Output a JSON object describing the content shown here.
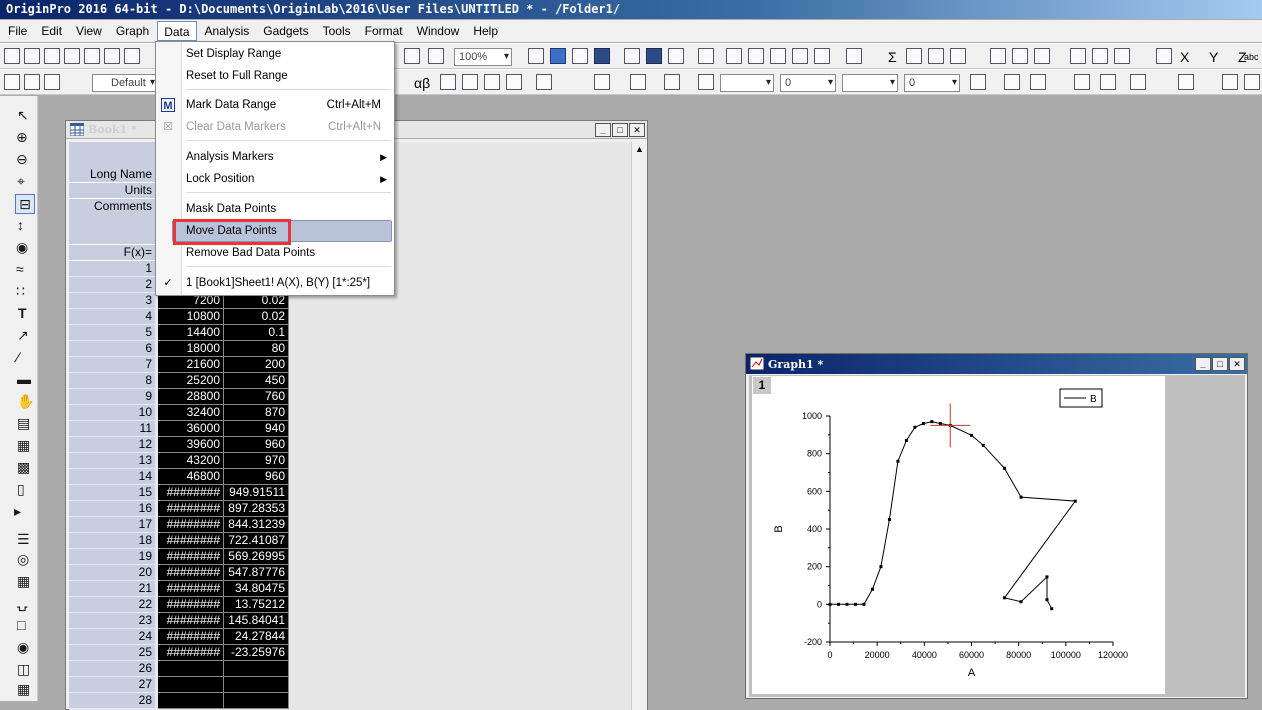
{
  "app": {
    "title": "OriginPro 2016 64-bit - D:\\Documents\\OriginLab\\2016\\User Files\\UNTITLED * - /Folder1/"
  },
  "menubar": {
    "items": [
      "File",
      "Edit",
      "View",
      "Graph",
      "Data",
      "Analysis",
      "Gadgets",
      "Tools",
      "Format",
      "Window",
      "Help"
    ],
    "active": "Data"
  },
  "toolbar": {
    "zoom": "100%",
    "font_name": "Default",
    "line_width_combo": "0",
    "fill_combo": "0",
    "text_tool_label": "T",
    "sigma": "Σ",
    "alpha_beta": "αβ",
    "xyz": "X Y Z",
    "abc": "abc"
  },
  "data_menu": {
    "items": [
      {
        "label": "Set Display Range",
        "shortcut": "",
        "enabled": true
      },
      {
        "label": "Reset to Full Range",
        "shortcut": "",
        "enabled": true
      },
      {
        "label": "Mark Data Range",
        "shortcut": "Ctrl+Alt+M",
        "enabled": true
      },
      {
        "label": "Clear Data Markers",
        "shortcut": "Ctrl+Alt+N",
        "enabled": false
      },
      {
        "label": "Analysis Markers",
        "shortcut": "",
        "enabled": true,
        "submenu": true
      },
      {
        "label": "Lock Position",
        "shortcut": "",
        "enabled": true,
        "submenu": true
      },
      {
        "label": "Mask Data Points",
        "shortcut": "",
        "enabled": true
      },
      {
        "label": "Move Data Points",
        "shortcut": "",
        "enabled": true,
        "highlighted": true
      },
      {
        "label": "Remove Bad Data Points",
        "shortcut": "",
        "enabled": true
      },
      {
        "label": "1    [Book1]Sheet1! A(X), B(Y) [1*:25*]",
        "shortcut": "",
        "enabled": true,
        "checked": true
      }
    ]
  },
  "book1": {
    "title": "Book1 *",
    "headers": {
      "long_name": "Long Name",
      "units": "Units",
      "comments": "Comments",
      "fx": "F(x)="
    },
    "rows": [
      {
        "n": "1",
        "a": "",
        "b": ""
      },
      {
        "n": "2",
        "a": "",
        "b": ""
      },
      {
        "n": "3",
        "a": "7200",
        "b": "0.02"
      },
      {
        "n": "4",
        "a": "10800",
        "b": "0.02"
      },
      {
        "n": "5",
        "a": "14400",
        "b": "0.1"
      },
      {
        "n": "6",
        "a": "18000",
        "b": "80"
      },
      {
        "n": "7",
        "a": "21600",
        "b": "200"
      },
      {
        "n": "8",
        "a": "25200",
        "b": "450"
      },
      {
        "n": "9",
        "a": "28800",
        "b": "760"
      },
      {
        "n": "10",
        "a": "32400",
        "b": "870"
      },
      {
        "n": "11",
        "a": "36000",
        "b": "940"
      },
      {
        "n": "12",
        "a": "39600",
        "b": "960"
      },
      {
        "n": "13",
        "a": "43200",
        "b": "970"
      },
      {
        "n": "14",
        "a": "46800",
        "b": "960"
      },
      {
        "n": "15",
        "a": "########",
        "b": "949.91511"
      },
      {
        "n": "16",
        "a": "########",
        "b": "897.28353"
      },
      {
        "n": "17",
        "a": "########",
        "b": "844.31239"
      },
      {
        "n": "18",
        "a": "########",
        "b": "722.41087"
      },
      {
        "n": "19",
        "a": "########",
        "b": "569.26995"
      },
      {
        "n": "20",
        "a": "########",
        "b": "547.87776"
      },
      {
        "n": "21",
        "a": "########",
        "b": "34.80475"
      },
      {
        "n": "22",
        "a": "########",
        "b": "13.75212"
      },
      {
        "n": "23",
        "a": "########",
        "b": "145.84041"
      },
      {
        "n": "24",
        "a": "########",
        "b": "24.27844"
      },
      {
        "n": "25",
        "a": "########",
        "b": "-23.25976"
      },
      {
        "n": "26",
        "a": "",
        "b": ""
      },
      {
        "n": "27",
        "a": "",
        "b": ""
      },
      {
        "n": "28",
        "a": "",
        "b": ""
      }
    ]
  },
  "graph1": {
    "title": "Graph1 *",
    "layer": "1",
    "legend": "B",
    "xlabel": "A",
    "ylabel": "B",
    "xticks": [
      "0",
      "20000",
      "40000",
      "60000",
      "80000",
      "100000",
      "120000"
    ],
    "yticks": [
      "-200",
      "0",
      "200",
      "400",
      "600",
      "800",
      "1000"
    ],
    "chart_data": {
      "type": "line",
      "xlabel": "A",
      "ylabel": "B",
      "xlim": [
        0,
        120000
      ],
      "ylim": [
        -200,
        1000
      ],
      "legend": "top-right",
      "series": [
        {
          "name": "B",
          "x": [
            0,
            3600,
            7200,
            10800,
            14400,
            18000,
            21600,
            25200,
            28800,
            32400,
            36000,
            39600,
            43200,
            46800,
            51000,
            60000,
            65000,
            74000,
            81000,
            104000,
            74000,
            81000,
            92000,
            92000,
            94000
          ],
          "y": [
            0,
            0,
            0.02,
            0.02,
            0.1,
            80,
            200,
            450,
            760,
            870,
            940,
            960,
            970,
            960,
            949.91511,
            897.28353,
            844.31239,
            722.41087,
            569.26995,
            547.87776,
            34.80475,
            13.75212,
            145.84041,
            24.27844,
            -23.25976
          ]
        }
      ]
    }
  },
  "colors": {
    "title_active": "#0a246a",
    "cell_bg": "#000000",
    "header_bg": "#c8cee0",
    "highlight_box": "#e8343d",
    "cursor_marker": "#c0392b"
  }
}
